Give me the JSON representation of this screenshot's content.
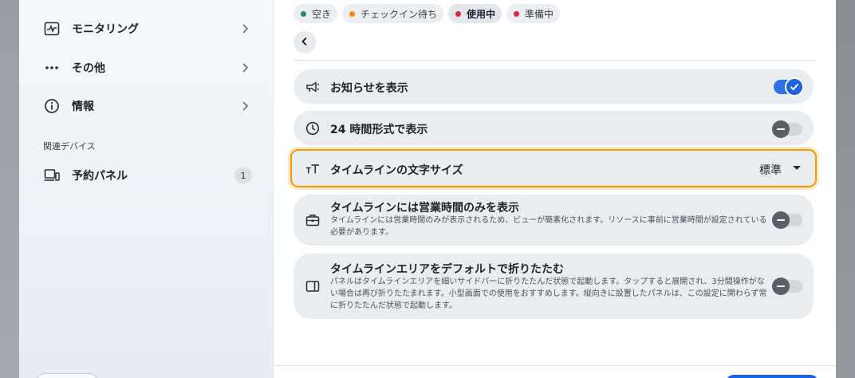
{
  "sidebar": {
    "items": [
      {
        "label": "モニタリング",
        "icon": "monitoring-icon"
      },
      {
        "label": "その他",
        "icon": "more-dots-icon"
      },
      {
        "label": "情報",
        "icon": "info-icon"
      }
    ],
    "section_label": "関連デバイス",
    "device_item": {
      "label": "予約パネル",
      "icon": "device-icon",
      "count": "1"
    }
  },
  "status_chips": [
    {
      "label": "空き",
      "color": "#1e8a6e"
    },
    {
      "label": "チェックイン待ち",
      "color": "#f08c00"
    },
    {
      "label": "使用中",
      "color": "#d7263d",
      "active": true
    },
    {
      "label": "準備中",
      "color": "#d7263d"
    }
  ],
  "settings": {
    "show_notice": {
      "title": "お知らせを表示",
      "enabled": true,
      "icon": "megaphone-icon"
    },
    "hour24": {
      "title": "24 時間形式で表示",
      "enabled": false,
      "icon": "clock-icon"
    },
    "timeline_font": {
      "title": "タイムラインの文字サイズ",
      "value": "標準",
      "icon": "text-size-icon"
    },
    "business_hours": {
      "title": "タイムラインには営業時間のみを表示",
      "description": "タイムラインには営業時間のみが表示されるため、ビューが簡素化されます。リソースに事前に営業時間が設定されている必要があります。",
      "enabled": false,
      "icon": "briefcase-icon"
    },
    "collapse_default": {
      "title": "タイムラインエリアをデフォルトで折りたたむ",
      "description": "パネルはタイムラインエリアを細いサイドバーに折りたたんだ状態で起動します。タップすると展開され、3分間操作がない場合は再び折りたたまれます。小型画面での使用をおすすめします。縦向きに設置したパネルは、この設定に関わらず常に折りたたんだ状態で起動します。",
      "enabled": false,
      "icon": "sidebar-panel-icon"
    }
  },
  "colors": {
    "accent": "#1d63e0",
    "focus": "#f29b05"
  }
}
